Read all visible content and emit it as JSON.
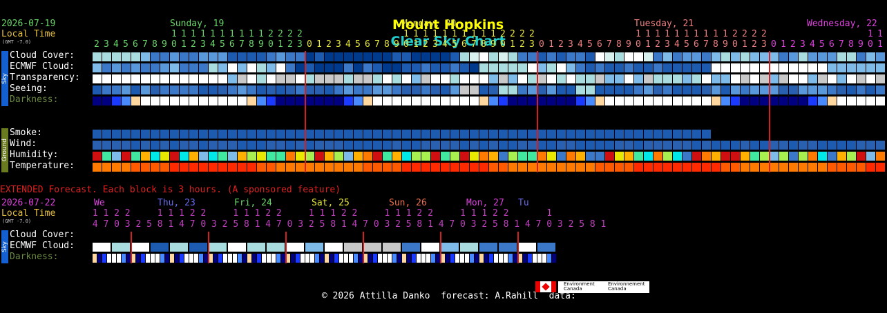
{
  "title": {
    "place": "Mount Hopkins",
    "chart": "Clear Sky Chart"
  },
  "colors": {
    "place": "#ffff00",
    "chart": "#22cccc",
    "grid_line": "#d42020"
  },
  "header": {
    "date": "2026-07-19",
    "local_time": "Local Time",
    "gmt": "(GMT -7.0)",
    "days": [
      {
        "label": "Sunday, 19",
        "color": "#6ad86a"
      },
      {
        "label": "Monday, 20",
        "color": "#e8e83a"
      },
      {
        "label": "Tuesday, 21",
        "color": "#f08080"
      },
      {
        "label": "Wednesday, 22",
        "color": "#e040e0"
      }
    ]
  },
  "sky_rows": [
    "Cloud Cover:",
    "ECMWF Cloud:",
    "Transparency:",
    "Seeing:",
    "Darkness:"
  ],
  "ground_rows": [
    "Smoke:",
    "Wind:",
    "Humidity:",
    "Temperature:"
  ],
  "sidebars": {
    "sky": "Sky",
    "ground": "Ground"
  },
  "extended": {
    "banner": "EXTENDED Forecast. Each block is 3 hours. (A sponsored feature)",
    "date": "2026-07-22",
    "local_time": "Local Time",
    "gmt": "(GMT -7.0)",
    "rows": [
      "Cloud Cover:",
      "ECMWF Cloud:",
      "Darkness:"
    ],
    "days": [
      {
        "label": "We",
        "color": "#e040e0"
      },
      {
        "label": "Thu, 23",
        "color": "#6a6af0"
      },
      {
        "label": "Fri, 24",
        "color": "#6ad86a"
      },
      {
        "label": "Sat, 25",
        "color": "#e8e83a"
      },
      {
        "label": "Sun, 26",
        "color": "#f07050"
      },
      {
        "label": "Mon, 27",
        "color": "#e040e0"
      },
      {
        "label": "Tu",
        "color": "#6a6af0"
      }
    ],
    "hours_tens": " 1 1 2 2     1 1 1 2 2     1 1 1 2 2     1 1 1 2 2     1 1 1 2 2     1 1 1 2 2       1",
    "hours_ones": " 4 7 0 3 2 5 8 1 4 7 0 3 2 5 8 1 4 7 0 3 2 5 8 1 4 7 0 3 2 5 8 1 4 7 0 3 2 5 8 1 4 7 0 3 2 5 8 1"
  },
  "footer": {
    "copyright": "© 2026 Attilla Danko  forecast: A.Rahill  data:",
    "env1": "Environment Canada",
    "env2": "Environnement Canada"
  }
}
